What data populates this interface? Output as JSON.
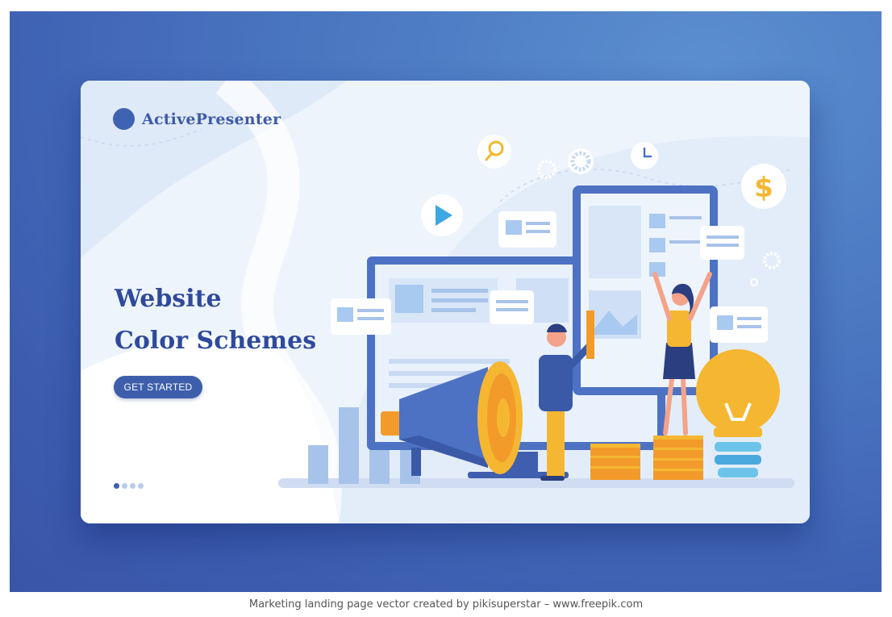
{
  "brand": {
    "name": "ActivePresenter"
  },
  "hero": {
    "headline_line1": "Website",
    "headline_line2": "Color Schemes",
    "cta_label": "GET STARTED"
  },
  "carousel": {
    "slide_count": 4,
    "active_index": 0
  },
  "caption": "Marketing landing page vector created by pikisuperstar – www.freepik.com",
  "colors": {
    "brand_blue": "#3e63b2",
    "headline_blue": "#2f4a9c",
    "accent_yellow": "#f5b731",
    "accent_orange": "#f29b2a",
    "stage_blue": "#4a76c0"
  },
  "illustration": {
    "icons": [
      "search-icon",
      "gear-icon",
      "clock-icon",
      "dollar-icon",
      "play-icon",
      "lightbulb-icon",
      "megaphone-icon",
      "coins-icon",
      "bar-chart-icon"
    ]
  }
}
